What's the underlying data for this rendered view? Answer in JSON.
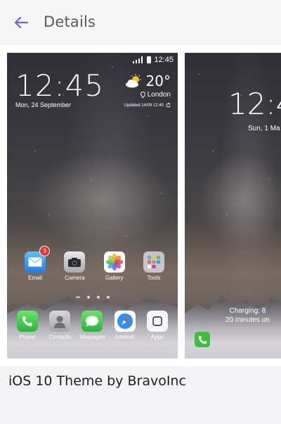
{
  "header": {
    "title": "Details",
    "back_icon": "arrow-left-icon",
    "accent": "#7a5fc8"
  },
  "preview_one": {
    "status_time": "12:45",
    "clock": "12:45",
    "date": "Mon, 24 September",
    "weather": {
      "temp": "20°",
      "location": "London",
      "updated": "Updated 14/09 12:45"
    },
    "home_apps": [
      {
        "label": "Email",
        "icon": "mail-icon",
        "badge": "3"
      },
      {
        "label": "Camera",
        "icon": "camera-icon"
      },
      {
        "label": "Gallery",
        "icon": "photos-icon"
      },
      {
        "label": "Tools",
        "icon": "folder-icon"
      }
    ],
    "dock_apps": [
      {
        "label": "Phone",
        "icon": "phone-icon"
      },
      {
        "label": "Contacts",
        "icon": "contacts-icon"
      },
      {
        "label": "Messages",
        "icon": "messages-icon"
      },
      {
        "label": "Internet",
        "icon": "compass-icon"
      },
      {
        "label": "Apps",
        "icon": "apps-icon"
      }
    ]
  },
  "preview_two": {
    "clock": "12:4",
    "date": "Sun, 1 Ma",
    "charging_line1": "Charging: 8",
    "charging_line2": "20 minutes un"
  },
  "theme": {
    "name": "iOS 10 Theme by BravoInc"
  }
}
